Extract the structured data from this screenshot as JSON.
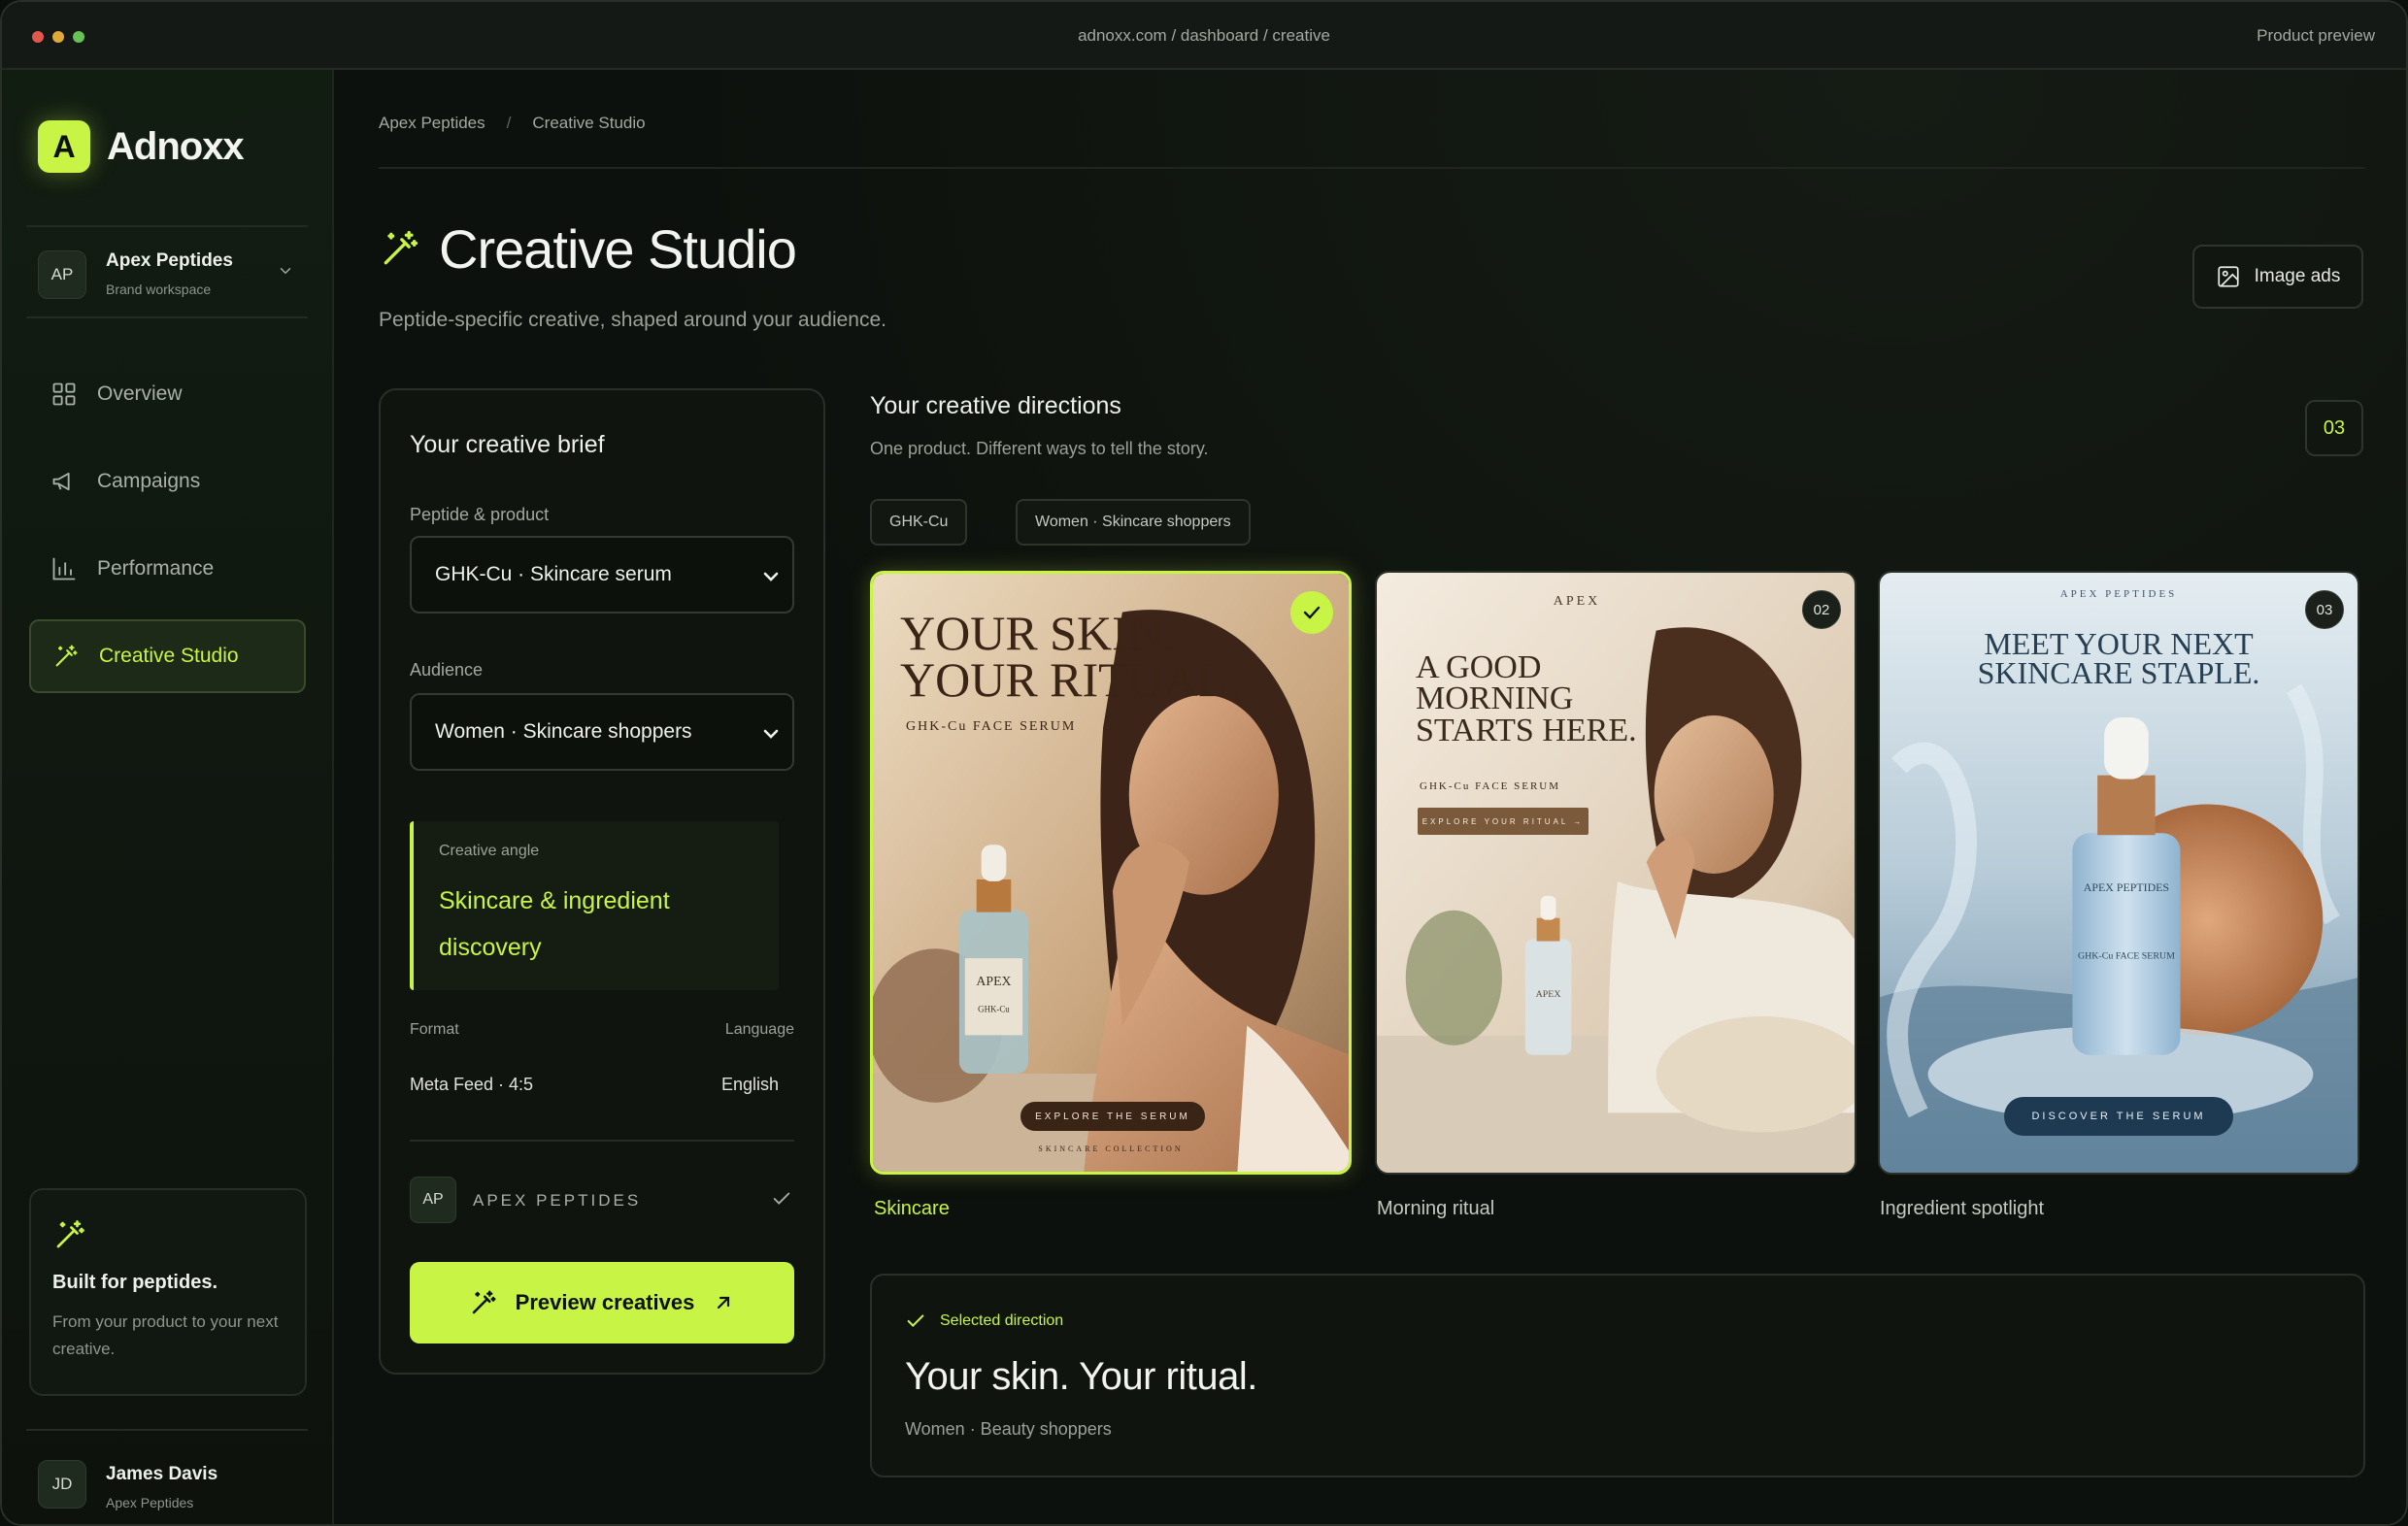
{
  "window": {
    "url": "adnoxx.com / dashboard / creative",
    "right_label": "Product preview"
  },
  "brand": {
    "logo_letter": "A",
    "name": "Adnoxx",
    "accent": "#c8f545"
  },
  "workspace": {
    "initials": "AP",
    "name": "Apex Peptides",
    "sub": "Brand workspace"
  },
  "nav": {
    "overview": "Overview",
    "campaigns": "Campaigns",
    "performance": "Performance",
    "creative_studio": "Creative Studio"
  },
  "promo": {
    "title": "Built for peptides.",
    "text": "From your product to your next creative."
  },
  "user": {
    "initials": "JD",
    "name": "James Davis",
    "sub": "Apex Peptides"
  },
  "breadcrumb": {
    "parent": "Apex Peptides",
    "sep": "/",
    "current": "Creative Studio"
  },
  "page": {
    "title": "Creative Studio",
    "subtitle": "Peptide-specific creative, shaped around your audience.",
    "image_ads_label": "Image ads"
  },
  "brief": {
    "title": "Your creative brief",
    "product_label": "Peptide & product",
    "product_value": "GHK-Cu · Skincare serum",
    "audience_label": "Audience",
    "audience_value": "Women · Skincare shoppers",
    "angle_label": "Creative angle",
    "angle_value": "Skincare & ingredient discovery",
    "format_label": "Format",
    "format_value": "Meta Feed · 4:5",
    "language_label": "Language",
    "language_value": "English",
    "brand_initials": "AP",
    "brand_name": "APEX PEPTIDES",
    "preview_label": "Preview creatives"
  },
  "directions": {
    "title": "Your creative directions",
    "subtitle": "One product. Different ways to tell the story.",
    "count": "03",
    "chips": [
      "GHK-Cu",
      "Women · Skincare shoppers"
    ],
    "cards": [
      {
        "caption": "Skincare",
        "headline": [
          "YOUR SKIN.",
          "YOUR RITUAL."
        ],
        "subline": "GHK-Cu FACE SERUM",
        "bottle_brand": "APEX",
        "bottle_text": "GHK-Cu",
        "cta": "EXPLORE THE SERUM",
        "footer": "SKINCARE COLLECTION"
      },
      {
        "num": "02",
        "caption": "Morning ritual",
        "brand": "APEX",
        "headline": [
          "A GOOD",
          "MORNING",
          "STARTS HERE."
        ],
        "subline": "GHK-Cu FACE SERUM",
        "cta": "EXPLORE YOUR RITUAL →",
        "bottle_brand": "APEX"
      },
      {
        "num": "03",
        "caption": "Ingredient spotlight",
        "brand": "APEX PEPTIDES",
        "headline": [
          "MEET YOUR NEXT",
          "SKINCARE STAPLE."
        ],
        "bottle_brand": "APEX PEPTIDES",
        "bottle_text": "GHK-Cu FACE SERUM",
        "cta": "DISCOVER THE SERUM"
      }
    ]
  },
  "selected": {
    "label": "Selected direction",
    "title": "Your skin. Your ritual.",
    "sub": "Women · Beauty shoppers"
  }
}
